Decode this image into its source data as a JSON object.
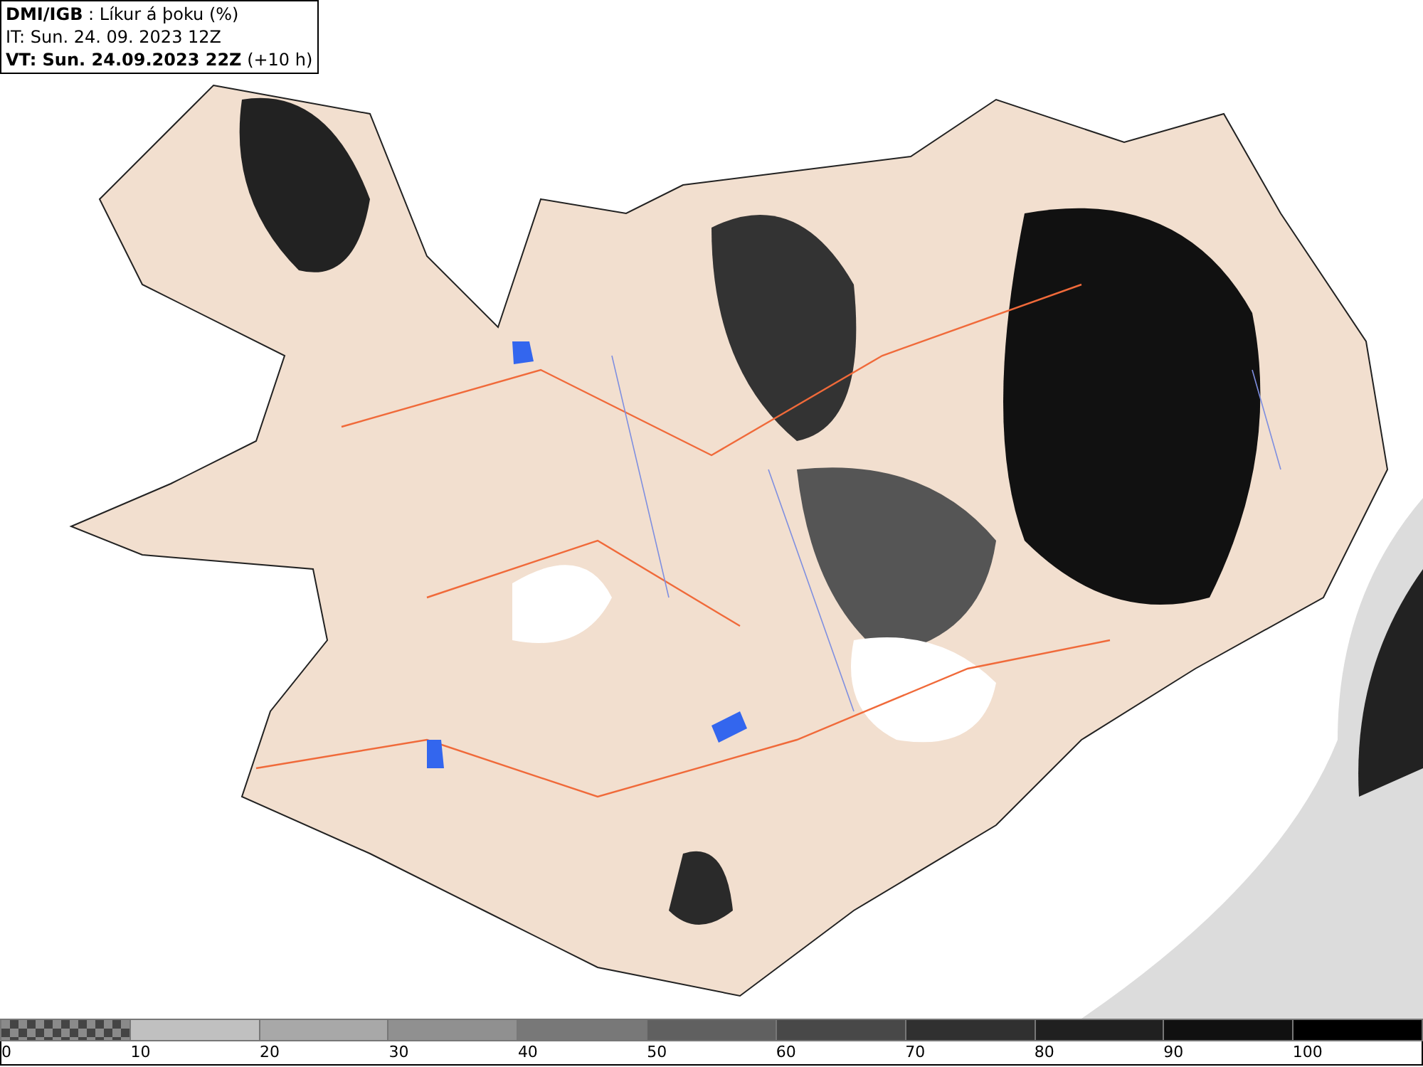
{
  "header": {
    "lines": [
      "**DMI/IGB** : Líkur á þoku (%)",
      "IT: Sun. 24. 09. 2023 12Z",
      "**VT: Sun. 24.09.2023 22Z** (+10 h)"
    ]
  },
  "legend": {
    "segments": [
      {
        "kind": "checker",
        "label": "0"
      },
      {
        "kind": "solid",
        "color": "#c0c0c0",
        "label": "10"
      },
      {
        "kind": "solid",
        "color": "#a8a8a8",
        "label": "20"
      },
      {
        "kind": "solid",
        "color": "#909090",
        "label": "30"
      },
      {
        "kind": "solid",
        "color": "#787878",
        "label": "40"
      },
      {
        "kind": "solid",
        "color": "#606060",
        "label": "50"
      },
      {
        "kind": "solid",
        "color": "#484848",
        "label": "60"
      },
      {
        "kind": "solid",
        "color": "#303030",
        "label": "70"
      },
      {
        "kind": "solid",
        "color": "#202020",
        "label": "80"
      },
      {
        "kind": "solid",
        "color": "#101010",
        "label": "90"
      },
      {
        "kind": "solid",
        "color": "#000000",
        "label": "100"
      }
    ]
  }
}
